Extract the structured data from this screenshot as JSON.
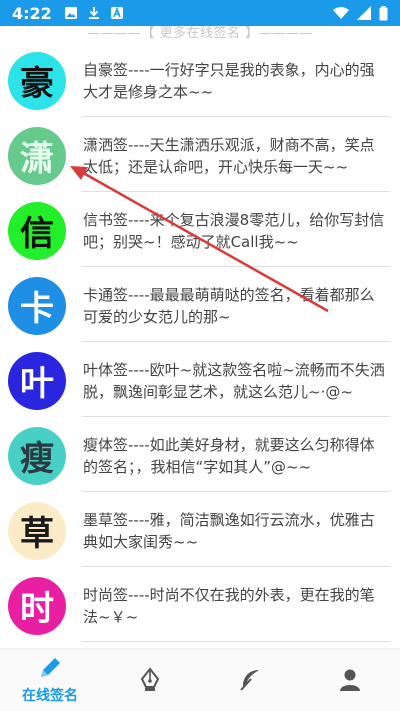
{
  "status_bar": {
    "time": "4:22",
    "left_icons": [
      "image-icon",
      "download-icon",
      "app-icon"
    ],
    "right_icons": [
      "wifi-icon",
      "signal-icon",
      "battery-icon"
    ]
  },
  "header": {
    "more_label": "————【 更多在线签名 】————"
  },
  "items": [
    {
      "char": "豪",
      "text": "自豪签----一行好字只是我的表象，内心的强大才是修身之本~~",
      "bg": "#2be3e8",
      "fg": "#111111"
    },
    {
      "char": "潇",
      "text": "潇洒签----天生潇洒乐观派，财商不高，笑点太低；还是认命吧，开心快乐每一天~~",
      "bg": "#66ca8c",
      "fg": "#e8fff0"
    },
    {
      "char": "信",
      "text": "信书签----来个复古浪漫8零范儿，给你写封信吧；别哭~！感动了就Call我~~",
      "bg": "#22ee2a",
      "fg": "#111111"
    },
    {
      "char": "卡",
      "text": "卡通签----最最最萌萌哒的签名，看着都那么可爱的少女范儿的那~",
      "bg": "#1f8fe6",
      "fg": "#ffffff"
    },
    {
      "char": "叶",
      "text": "叶体签----欧叶~就这款签名啦~流畅而不失洒脱，飘逸间彰显艺术，就这么范儿~·@~",
      "bg": "#2a26e0",
      "fg": "#ffffff"
    },
    {
      "char": "瘦",
      "text": "瘦体签----如此美好身材，就要这么匀称得体的签名；，我相信“字如其人”@~~",
      "bg": "#48cfc6",
      "fg": "#2a3a40"
    },
    {
      "char": "草",
      "text": "墨草签----雅，简洁飘逸如行云流水，优雅古典如大家闺秀~~",
      "bg": "#fbecc7",
      "fg": "#1a1a1a"
    },
    {
      "char": "时",
      "text": "时尚签----时尚不仅在我的外表，更在我的笔法~￥~",
      "bg": "#e81fa3",
      "fg": "#ffffff"
    },
    {
      "char": "",
      "text": "",
      "bg": "#22b04a",
      "fg": "#ffffff"
    }
  ],
  "bottom_nav": {
    "tabs": [
      {
        "icon": "pencil-icon",
        "label": "在线签名",
        "active": true
      },
      {
        "icon": "pen-nib-icon",
        "label": "",
        "active": false
      },
      {
        "icon": "feather-icon",
        "label": "",
        "active": false
      },
      {
        "icon": "user-icon",
        "label": "",
        "active": false
      }
    ]
  },
  "colors": {
    "accent": "#1a9ae9",
    "divider": "#e0e0e0",
    "annotation_arrow": "#d93b3b"
  }
}
